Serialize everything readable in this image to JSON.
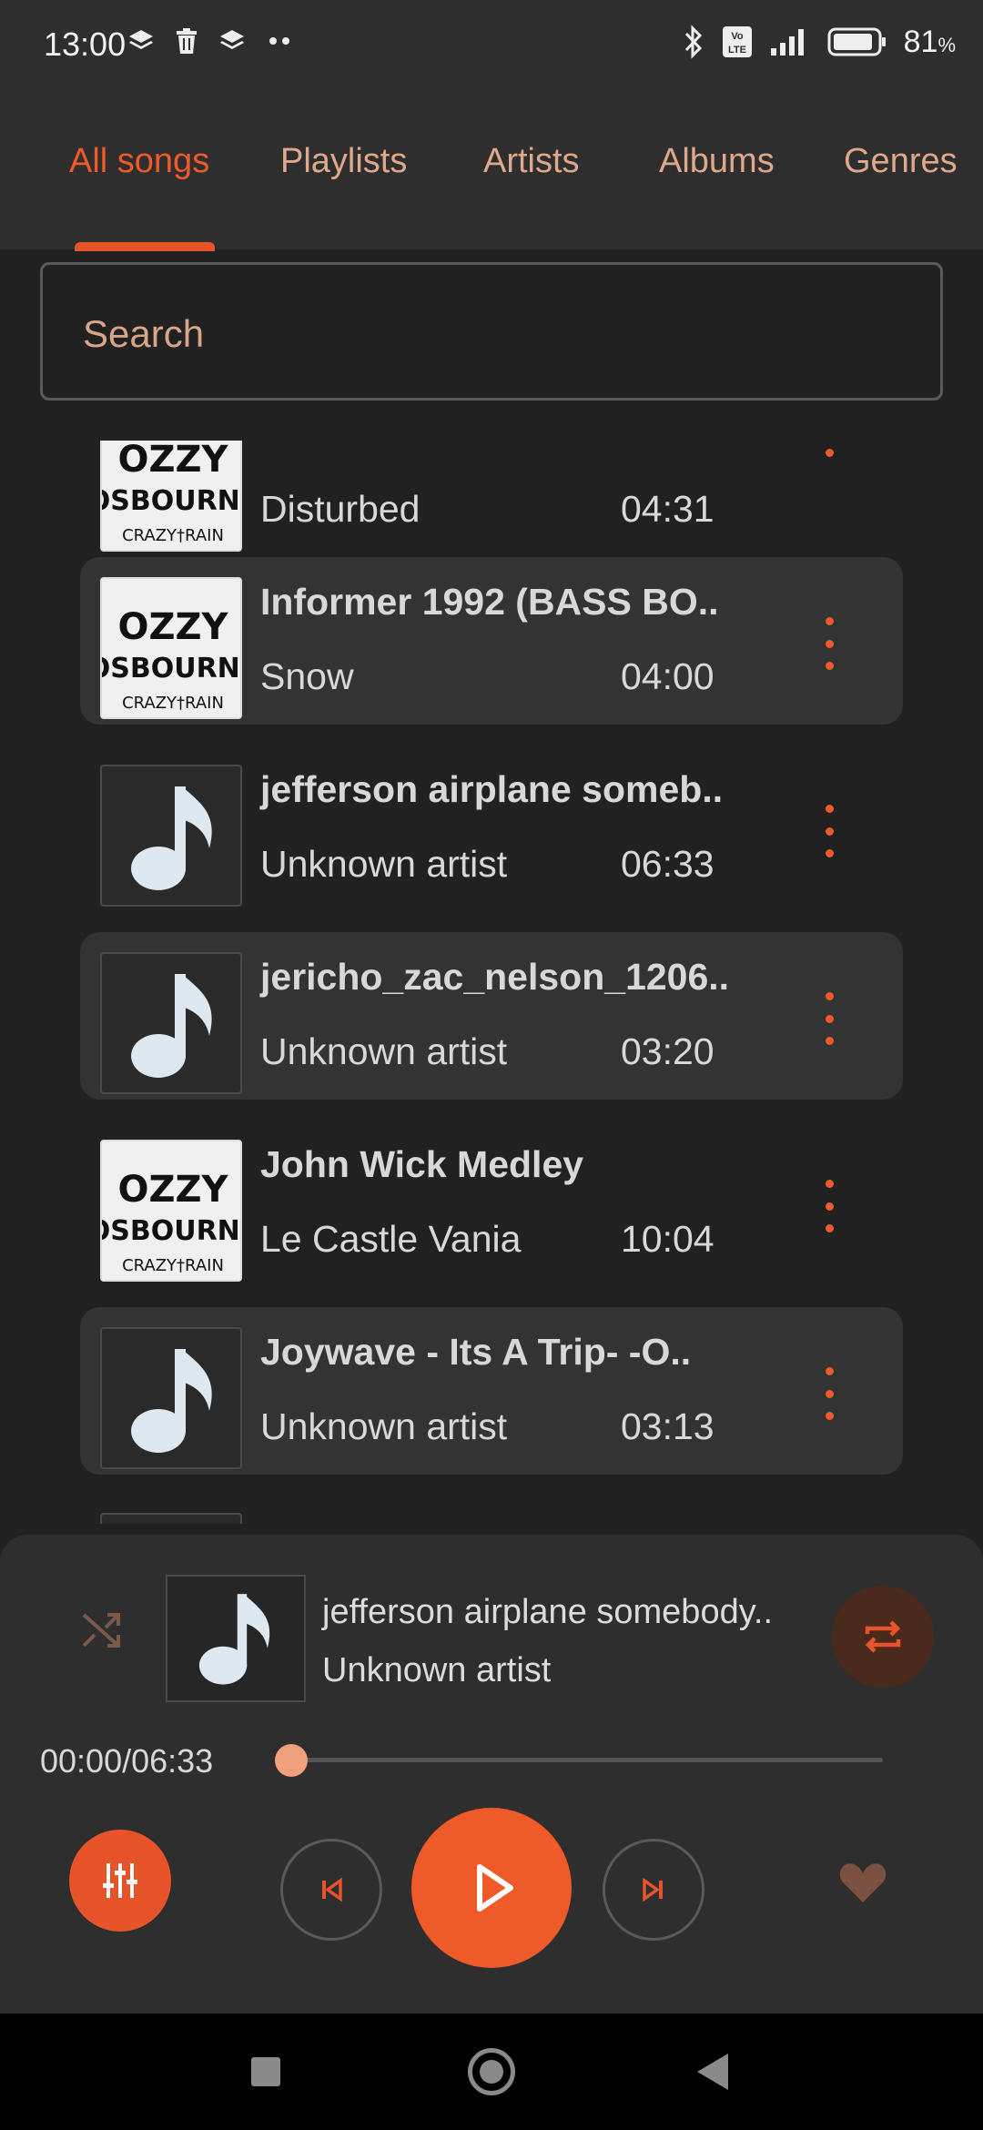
{
  "status_bar": {
    "time": "13:00",
    "battery_percent": "81",
    "battery_unit": "%",
    "volte_label": "Vo LTE",
    "icons_left": [
      "layers-icon",
      "trash-icon",
      "layers-icon",
      "more-dots-icon"
    ],
    "icons_right": [
      "bluetooth-icon",
      "volte-icon",
      "signal-icon",
      "battery-icon"
    ]
  },
  "tabs": [
    {
      "label": "All songs",
      "active": true
    },
    {
      "label": "Playlists",
      "active": false
    },
    {
      "label": "Artists",
      "active": false
    },
    {
      "label": "Albums",
      "active": false
    },
    {
      "label": "Genres",
      "active": false
    }
  ],
  "search": {
    "placeholder": "Search"
  },
  "songs": [
    {
      "title": "",
      "artist": "Disturbed",
      "duration": "04:31",
      "art": "album-art"
    },
    {
      "title": "Informer 1992 (BASS BO..",
      "artist": "Snow",
      "duration": "04:00",
      "art": "album-art"
    },
    {
      "title": "jefferson airplane someb..",
      "artist": "Unknown artist",
      "duration": "06:33",
      "art": "music-note"
    },
    {
      "title": "jericho_zac_nelson_1206..",
      "artist": "Unknown artist",
      "duration": "03:20",
      "art": "music-note"
    },
    {
      "title": "John Wick Medley",
      "artist": "Le Castle Vania",
      "duration": "10:04",
      "art": "album-art"
    },
    {
      "title": "Joywave - Its A Trip- -O..",
      "artist": "Unknown artist",
      "duration": "03:13",
      "art": "music-note"
    }
  ],
  "album_art_text": {
    "line1": "OZZY",
    "line2": "OSBOURNE",
    "line3": "CRAZY†RAIN"
  },
  "player": {
    "title": "jefferson airplane somebody..",
    "artist": "Unknown artist",
    "time": "00:00/06:33",
    "progress": 0.0
  },
  "colors": {
    "accent": "#e8542a",
    "background": "#212121",
    "surface": "#2e2e2e",
    "tab_inactive": "#e0a88a"
  }
}
